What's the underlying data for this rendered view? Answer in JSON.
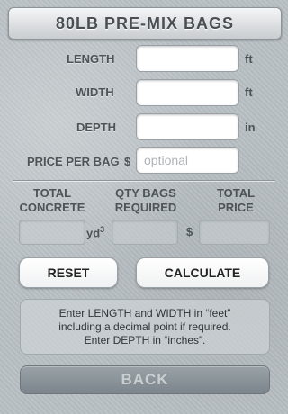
{
  "title": "80LB PRE-MIX BAGS",
  "fields": {
    "length": {
      "label": "LENGTH",
      "unit": "ft",
      "value": "",
      "placeholder": ""
    },
    "width": {
      "label": "WIDTH",
      "unit": "ft",
      "value": "",
      "placeholder": ""
    },
    "depth": {
      "label": "DEPTH",
      "unit": "in",
      "value": "",
      "placeholder": ""
    },
    "price": {
      "label": "PRICE PER BAG",
      "currency": "$",
      "value": "",
      "placeholder": "optional"
    }
  },
  "results": {
    "total_concrete": {
      "line1": "TOTAL",
      "line2": "CONCRETE",
      "unit_base": "yd",
      "unit_exp": "3"
    },
    "qty_bags": {
      "line1": "QTY BAGS",
      "line2": "REQUIRED"
    },
    "total_price": {
      "line1": "TOTAL",
      "line2": "PRICE",
      "currency": "$"
    }
  },
  "buttons": {
    "reset": "RESET",
    "calculate": "CALCULATE",
    "back": "BACK"
  },
  "info": {
    "line1": "Enter LENGTH and WIDTH in “feet”",
    "line2": "including a decimal point if required.",
    "line3": "Enter DEPTH in “inches”."
  }
}
